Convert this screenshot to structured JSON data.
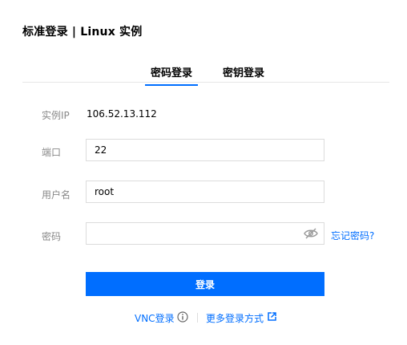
{
  "page": {
    "title": "标准登录 | Linux 实例"
  },
  "tabs": [
    {
      "label": "密码登录",
      "active": true
    },
    {
      "label": "密钥登录",
      "active": false
    }
  ],
  "form": {
    "ip_label": "实例IP",
    "ip_value": "106.52.13.112",
    "port_label": "端口",
    "port_value": "22",
    "user_label": "用户名",
    "user_value": "root",
    "password_label": "密码",
    "password_value": "",
    "forgot_label": "忘记密码?",
    "login_label": "登录"
  },
  "footer": {
    "vnc_label": "VNC登录",
    "more_label": "更多登录方式"
  },
  "icons": {
    "eye": "eye-off-icon",
    "info": "info-circle-icon",
    "external": "external-link-icon"
  },
  "colors": {
    "accent": "#006eff",
    "label": "#888888",
    "border": "#dcdcdc"
  }
}
